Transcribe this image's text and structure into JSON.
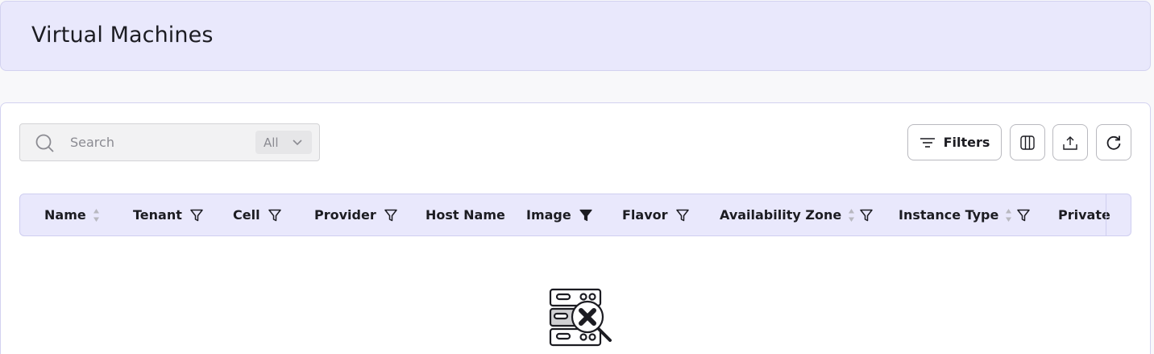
{
  "header": {
    "title": "Virtual Machines"
  },
  "toolbar": {
    "search_placeholder": "Search",
    "scope_value": "All",
    "filters_label": "Filters"
  },
  "table": {
    "columns": [
      {
        "label": "Name",
        "sortable": true,
        "filter": "none"
      },
      {
        "label": "Tenant",
        "sortable": false,
        "filter": "outline"
      },
      {
        "label": "Cell",
        "sortable": false,
        "filter": "outline"
      },
      {
        "label": "Provider",
        "sortable": false,
        "filter": "outline"
      },
      {
        "label": "Host Name",
        "sortable": false,
        "filter": "none"
      },
      {
        "label": "Image",
        "sortable": false,
        "filter": "filled"
      },
      {
        "label": "Flavor",
        "sortable": false,
        "filter": "outline"
      },
      {
        "label": "Availability Zone",
        "sortable": true,
        "filter": "outline"
      },
      {
        "label": "Instance Type",
        "sortable": true,
        "filter": "outline"
      },
      {
        "label": "Private",
        "sortable": false,
        "filter": "none"
      }
    ]
  },
  "empty_state": {
    "icon": "no-servers-found-icon"
  },
  "icons": {
    "search": "search-icon",
    "chevron": "chevron-down-icon",
    "filters": "filter-lines-icon",
    "columns": "columns-icon",
    "export": "upload-icon",
    "refresh": "refresh-icon",
    "sort": "sort-icon",
    "filter": "funnel-icon"
  },
  "colors": {
    "header_bg": "#e9e8fc",
    "border": "#d3d2f0",
    "text": "#1c1c22",
    "muted": "#8b8b92"
  }
}
